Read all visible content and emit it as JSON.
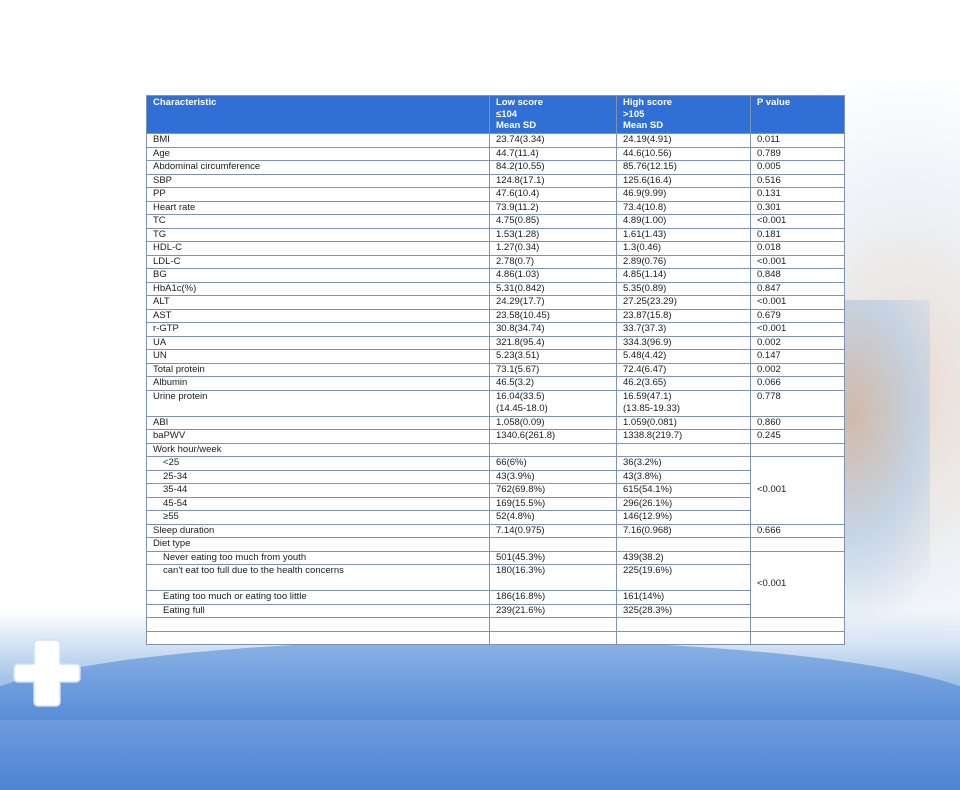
{
  "table": {
    "headers": [
      "Characteristic",
      "Low score\n≤104\nMean SD",
      "High score\n>105\nMean SD",
      "P value"
    ],
    "rows": [
      [
        "BMI",
        "23.74(3.34)",
        "24.19(4.91)",
        "0.011"
      ],
      [
        "Age",
        "44.7(11.4)",
        "44.6(10.56)",
        "0.789"
      ],
      [
        "Abdominal circumference",
        "84.2(10.55)",
        "85.76(12.15)",
        "0.005"
      ],
      [
        "SBP",
        "124.8(17.1)",
        "125.6(16.4)",
        "0.516"
      ],
      [
        "PP",
        "47.6(10.4)",
        "46.9(9.99)",
        "0.131"
      ],
      [
        "Heart rate",
        "73.9(11.2)",
        "73.4(10.8)",
        "0.301"
      ],
      [
        "TC",
        "4.75(0.85)",
        "4.89(1.00)",
        "<0.001"
      ],
      [
        "TG",
        "1.53(1.28)",
        "1.61(1.43)",
        "0.181"
      ],
      [
        "HDL-C",
        "1.27(0.34)",
        "1.3(0.46)",
        "0.018"
      ],
      [
        "LDL-C",
        "2.78(0.7)",
        "2.89(0.76)",
        "<0.001"
      ],
      [
        "BG",
        "4.86(1.03)",
        "4.85(1.14)",
        "0.848"
      ],
      [
        "HbA1c(%)",
        "5.31(0.842)",
        "5.35(0.89)",
        "0.847"
      ],
      [
        "ALT",
        "24.29(17.7)",
        "27.25(23.29)",
        "<0.001"
      ],
      [
        "AST",
        "23.58(10.45)",
        "23.87(15.8)",
        "0.679"
      ],
      [
        "r-GTP",
        "30.8(34.74)",
        "33.7(37.3)",
        "<0.001"
      ],
      [
        "UA",
        "321.8(95.4)",
        "334.3(96.9)",
        "0.002"
      ],
      [
        "UN",
        "5.23(3.51)",
        "5.48(4.42)",
        "0.147"
      ],
      [
        "Total protein",
        "73.1(5.67)",
        "72.4(6.47)",
        "0.002"
      ],
      [
        "Albumin",
        "46.5(3.2)",
        "46.2(3.65)",
        "0.066"
      ],
      [
        "Urine protein",
        "16.04(33.5)\n(14.45-18.0)",
        "16.59(47.1)\n(13.85-19.33)",
        "0.778"
      ],
      [
        "ABI",
        "1.058(0.09)",
        "1.059(0.081)",
        "0.860"
      ],
      [
        "baPWV",
        "1340.6(261.8)",
        "1338.8(219.7)",
        "0.245"
      ]
    ],
    "work_hours": {
      "label": "Work hour/week",
      "p_value": "<0.001",
      "rows": [
        [
          "<25",
          "66(6%)",
          "36(3.2%)"
        ],
        [
          "25-34",
          "43(3.9%)",
          "43(3.8%)"
        ],
        [
          "35-44",
          "762(69.8%)",
          "615(54.1%)"
        ],
        [
          "45-54",
          "169(15.5%)",
          "296(26.1%)"
        ],
        [
          "≥55",
          "52(4.8%)",
          "146(12.9%)"
        ]
      ]
    },
    "sleep": [
      "Sleep duration",
      "7.14(0.975)",
      "7.16(0.968)",
      "0.666"
    ],
    "diet": {
      "label": "Diet type",
      "p_value": "<0.001",
      "rows": [
        [
          "Never eating too much from youth",
          "501(45.3%)",
          "439(38.2)"
        ],
        [
          "can't eat too full due to the health concerns",
          "180(16.3%)",
          "225(19.6%)"
        ],
        [
          "Eating too much or eating too little",
          "186(16.8%)",
          "161(14%)"
        ],
        [
          "Eating full",
          "239(21.6%)",
          "325(28.3%)"
        ]
      ]
    }
  },
  "colors": {
    "header_bg": "#2f6fd6",
    "header_text": "#ffffff",
    "border": "#7f93ad",
    "accent_wave": "#2f6fcc"
  },
  "icons": {
    "logo": "plus-icon"
  }
}
